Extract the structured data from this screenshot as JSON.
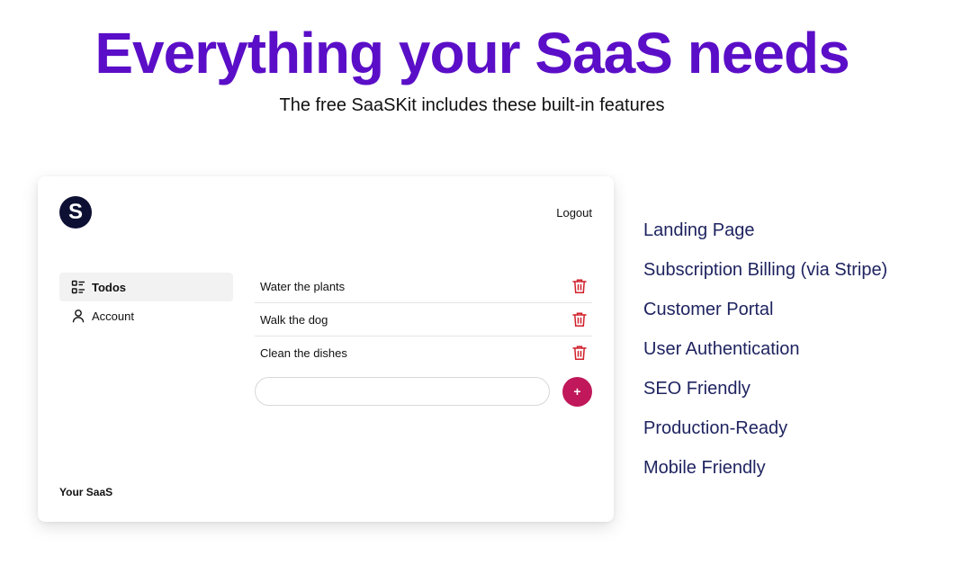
{
  "hero": {
    "title": "Everything your SaaS needs",
    "subtitle": "The free SaaSKit includes these built-in features"
  },
  "app": {
    "logo_letter": "S",
    "logout_label": "Logout",
    "sidebar": {
      "items": [
        {
          "label": "Todos",
          "icon": "list-icon",
          "active": true
        },
        {
          "label": "Account",
          "icon": "user-icon",
          "active": false
        }
      ]
    },
    "todos": [
      {
        "text": "Water the plants"
      },
      {
        "text": "Walk the dog"
      },
      {
        "text": "Clean the dishes"
      }
    ],
    "new_todo": {
      "value": "",
      "placeholder": ""
    },
    "add_label": "+",
    "footer_brand": "Your SaaS",
    "colors": {
      "accent": "#c0185a",
      "trash": "#d0202b",
      "logo_bg": "#0d1033"
    }
  },
  "features": [
    "Landing Page",
    "Subscription Billing (via Stripe)",
    "Customer Portal",
    "User Authentication",
    "SEO Friendly",
    "Production-Ready",
    "Mobile Friendly"
  ],
  "colors": {
    "title": "#5b0ec7",
    "feature_text": "#1f2460"
  }
}
